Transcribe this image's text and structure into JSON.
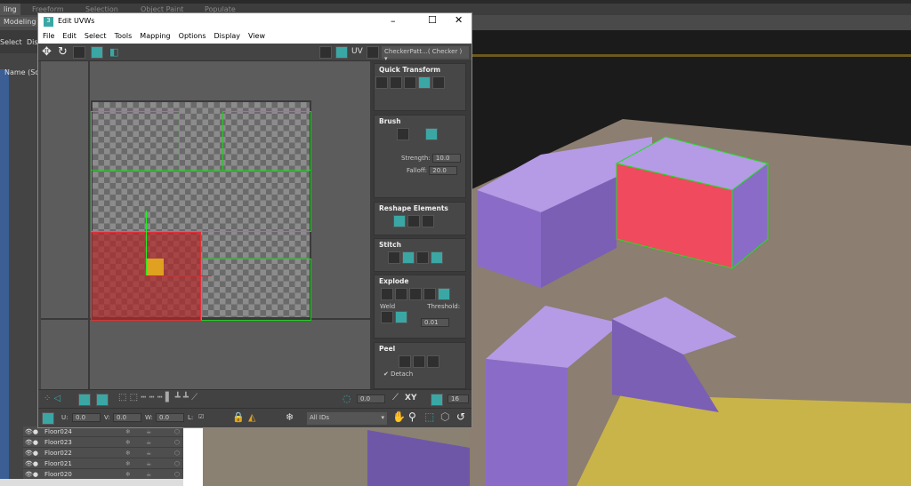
{
  "ribbon": {
    "tabs": [
      "ling",
      "Freeform",
      "Selection",
      "Object Paint",
      "Populate"
    ],
    "modeling": "Modeling",
    "row3": [
      "Select",
      "Disp"
    ]
  },
  "outliner": {
    "header": "Name (Sort",
    "rows": [
      {
        "name": "Floor024"
      },
      {
        "name": "Floor023"
      },
      {
        "name": "Floor022"
      },
      {
        "name": "Floor021"
      },
      {
        "name": "Floor020"
      }
    ]
  },
  "uvw": {
    "title": "Edit UVWs",
    "app_icon": "3",
    "menu": [
      "File",
      "Edit",
      "Select",
      "Tools",
      "Mapping",
      "Options",
      "Display",
      "View"
    ],
    "uv_label": "UV",
    "texture_dropdown": "CheckerPatt...( Checker )",
    "panel": {
      "quick_transform": "Quick Transform",
      "brush": "Brush",
      "strength_label": "Strength:",
      "strength": "10.0",
      "falloff_label": "Falloff:",
      "falloff": "20.0",
      "reshape": "Reshape Elements",
      "stitch": "Stitch",
      "explode": "Explode",
      "weld": "Weld",
      "threshold_label": "Threshold:",
      "threshold": "0.01",
      "peel": "Peel",
      "detach": "Detach"
    },
    "bottom": {
      "angle": "0.0",
      "xy": "XY",
      "grid": "16",
      "u_label": "U:",
      "u": "0.0",
      "v_label": "V:",
      "v": "0.0",
      "w_label": "W:",
      "w": "0.0",
      "l_label": "L:",
      "ids": "All IDs"
    }
  },
  "colors": {
    "accent": "#3aa7a5",
    "selection": "#b03a3a",
    "uv_edge": "#22cc22",
    "box": "#9a7fd0",
    "floor": "#c9b44a"
  }
}
